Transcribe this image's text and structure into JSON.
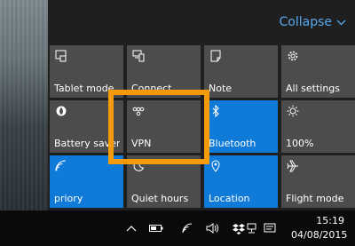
{
  "header": {
    "collapse_label": "Collapse"
  },
  "tiles": [
    {
      "label": "Tablet mode",
      "icon": "tablet-mode-icon",
      "active": false
    },
    {
      "label": "Connect",
      "icon": "connect-icon",
      "active": false
    },
    {
      "label": "Note",
      "icon": "note-icon",
      "active": false
    },
    {
      "label": "All settings",
      "icon": "gear-icon",
      "active": false
    },
    {
      "label": "Battery saver",
      "icon": "battery-saver-icon",
      "active": false
    },
    {
      "label": "VPN",
      "icon": "vpn-icon",
      "active": false
    },
    {
      "label": "Bluetooth",
      "icon": "bluetooth-icon",
      "active": true
    },
    {
      "label": "100%",
      "icon": "brightness-icon",
      "active": false
    },
    {
      "label": "priory",
      "icon": "wifi-icon",
      "active": true
    },
    {
      "label": "Quiet hours",
      "icon": "moon-icon",
      "active": false
    },
    {
      "label": "Location",
      "icon": "location-icon",
      "active": true
    },
    {
      "label": "Flight mode",
      "icon": "airplane-icon",
      "active": false
    }
  ],
  "taskbar": {
    "time": "15:19",
    "date": "04/08/2015",
    "tray_icons": [
      "chevron-up-icon",
      "battery-icon",
      "wifi-icon",
      "volume-icon",
      "dropbox-icon",
      "network-icon",
      "notification-icon"
    ]
  },
  "colors": {
    "accent": "#0f7ad8",
    "tile": "#4c4c4c",
    "link": "#56a9f0",
    "highlight": "#f59a0a"
  }
}
